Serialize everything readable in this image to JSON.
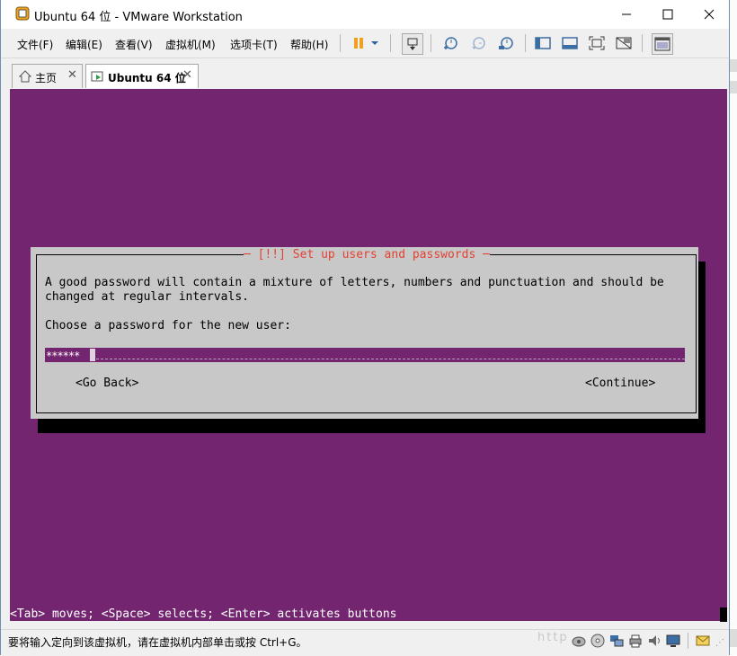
{
  "window": {
    "title": "Ubuntu 64 位 - VMware Workstation"
  },
  "menu": {
    "items": [
      "文件(F)",
      "编辑(E)",
      "查看(V)",
      "虚拟机(M)",
      "选项卡(T)",
      "帮助(H)"
    ]
  },
  "toolbar": {
    "icons": [
      "pause-icon",
      "dropdown-arrow-icon",
      "send-ctrl-alt-del-icon",
      "snapshot-take-icon",
      "snapshot-revert-icon",
      "snapshot-manager-icon",
      "show-library-icon",
      "thumbnail-bar-icon",
      "fullscreen-icon",
      "unity-icon",
      "console-view-icon"
    ]
  },
  "tabs": [
    {
      "label": "主页",
      "icon": "home-icon",
      "active": false
    },
    {
      "label": "Ubuntu 64 位",
      "icon": "vm-icon",
      "active": true
    }
  ],
  "installer": {
    "dialog_title": "[!!] Set up users and passwords",
    "line1": "A good password will contain a mixture of letters, numbers and punctuation and should be",
    "line2": "changed at regular intervals.",
    "prompt": "Choose a password for the new user:",
    "password_mask": "******",
    "go_back": "<Go Back>",
    "continue": "<Continue>",
    "help_line": "<Tab> moves; <Space> selects; <Enter> activates buttons"
  },
  "statusbar": {
    "text": "要将输入定向到该虚拟机，请在虚拟机内部单击或按 Ctrl+G。",
    "watermark": "http"
  },
  "colors": {
    "vm_background": "#732570",
    "dialog_background": "#c8c8c8",
    "dialog_title": "#e34234"
  }
}
